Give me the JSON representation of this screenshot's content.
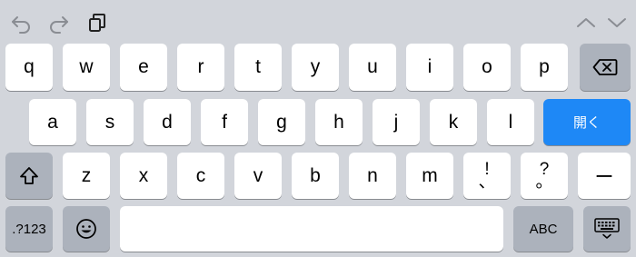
{
  "toolbar": {
    "undo_icon": "undo-arrow-icon",
    "redo_icon": "redo-arrow-icon",
    "paste_icon": "clipboard-paste-icon",
    "prev_icon": "chevron-up-icon",
    "next_icon": "chevron-down-icon"
  },
  "keyboard": {
    "row1": [
      "q",
      "w",
      "e",
      "r",
      "t",
      "y",
      "u",
      "i",
      "o",
      "p"
    ],
    "row2": [
      "a",
      "s",
      "d",
      "f",
      "g",
      "h",
      "j",
      "k",
      "l"
    ],
    "row3": [
      "z",
      "x",
      "c",
      "v",
      "b",
      "n",
      "m"
    ],
    "punct1": {
      "top": "!",
      "bottom": "、"
    },
    "punct2": {
      "top": "?",
      "bottom": "。"
    },
    "dash": "ー",
    "return_label": "開く",
    "numbers_label": ".?123",
    "abc_label": "ABC",
    "space_label": ""
  },
  "colors": {
    "background": "#d2d5db",
    "key": "#ffffff",
    "function_key": "#acb2bc",
    "accent": "#1e88f6"
  }
}
